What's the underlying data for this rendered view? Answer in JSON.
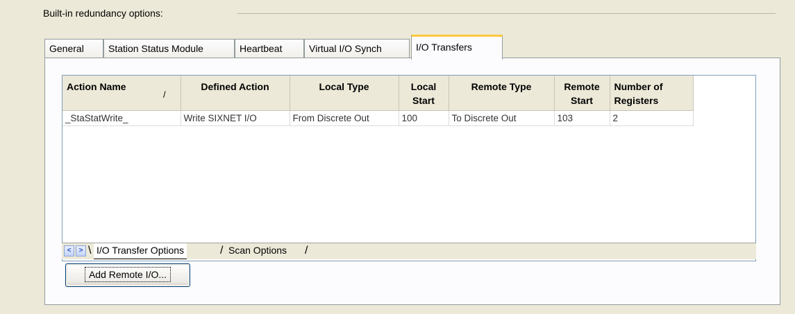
{
  "group": {
    "title": "Built-in redundancy options:"
  },
  "tabs": [
    {
      "label": "General"
    },
    {
      "label": "Station Status Module"
    },
    {
      "label": "Heartbeat"
    },
    {
      "label": "Virtual I/O Synch"
    },
    {
      "label": "I/O Transfers",
      "active": true
    }
  ],
  "table": {
    "columns": [
      {
        "label": "Action Name"
      },
      {
        "label": "Defined Action"
      },
      {
        "label": "Local Type"
      },
      {
        "label": "Local\nStart"
      },
      {
        "label": "Remote Type"
      },
      {
        "label": "Remote\nStart"
      },
      {
        "label": "Number of\nRegisters"
      }
    ],
    "sort_indicator": "/",
    "rows": [
      {
        "action_name": "_StaStatWrite_",
        "defined_action": "Write SIXNET I/O",
        "local_type": "From Discrete Out",
        "local_start": "100",
        "remote_type": "To Discrete Out",
        "remote_start": "103",
        "registers": "2"
      }
    ]
  },
  "sheet_tabs": [
    {
      "label": "I/O Transfer Options",
      "active": true
    },
    {
      "label": "Scan Options"
    }
  ],
  "nav": {
    "prev": "<",
    "next": ">"
  },
  "add_button": {
    "label": "Add Remote I/O..."
  },
  "colors": {
    "active_tab_accent": "#ffc83c",
    "panel_bg": "#fcfcfe",
    "dialog_bg": "#ece9d8"
  }
}
